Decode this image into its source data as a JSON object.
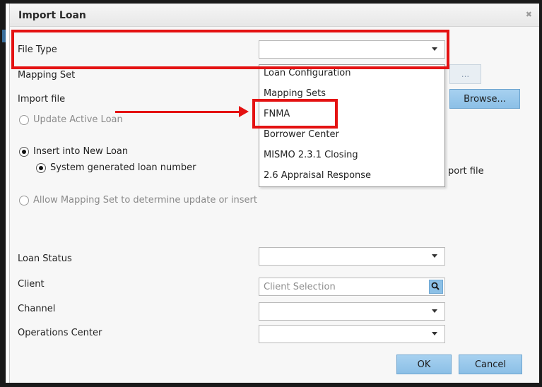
{
  "dialog": {
    "title": "Import Loan",
    "close_icon": "close-icon"
  },
  "form": {
    "file_type_label": "File Type",
    "file_type_value": "",
    "mapping_set_label": "Mapping Set",
    "mapping_set_button": "...",
    "import_file_label": "Import file",
    "browse_label": "Browse...",
    "update_active_loan_label": "Update Active Loan",
    "insert_new_loan_label": "Insert into New Loan",
    "system_generated_label": "System generated loan number",
    "import_file_suffix": "port file",
    "allow_mapping_label": "Allow Mapping Set to determine update or insert",
    "loan_status_label": "Loan Status",
    "client_label": "Client",
    "client_placeholder": "Client Selection",
    "channel_label": "Channel",
    "operations_center_label": "Operations Center"
  },
  "radios": {
    "update_active_loan": false,
    "insert_new_loan": true,
    "system_generated": true,
    "allow_mapping": false
  },
  "file_type_options": [
    "Loan Configuration",
    "Mapping Sets",
    "FNMA",
    "Borrower Center",
    "MISMO 2.3.1 Closing",
    "2.6 Appraisal Response"
  ],
  "footer": {
    "ok_label": "OK",
    "cancel_label": "Cancel"
  },
  "colors": {
    "highlight": "#e41212",
    "button_blue": "#8bbfe6"
  },
  "icons": {
    "search": "search-icon",
    "caret": "chevron-down-icon"
  }
}
